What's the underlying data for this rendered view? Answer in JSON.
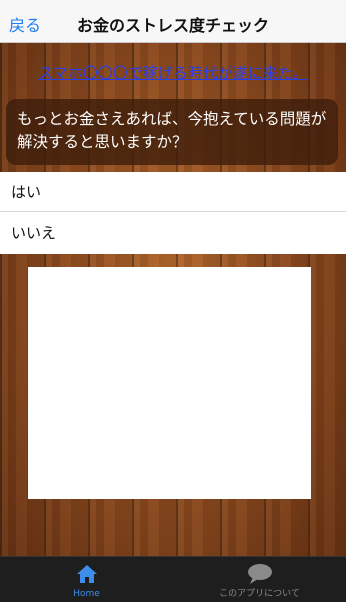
{
  "nav": {
    "back_label": "戻る",
    "title": "お金のストレス度チェック"
  },
  "ad_link": {
    "text": "スマホ〇〇〇で稼げる時代が遂に来た。"
  },
  "question": {
    "text": "もっとお金さえあれば、今抱えている問題が解決すると思いますか？"
  },
  "answers": [
    {
      "label": "はい"
    },
    {
      "label": "いいえ"
    }
  ],
  "tabbar": {
    "tabs": [
      {
        "label": "Home",
        "icon": "home-icon",
        "selected": true
      },
      {
        "label": "このアプリについて",
        "icon": "speech-bubble-icon",
        "selected": false
      }
    ]
  },
  "colors": {
    "link": "#2a3fe8",
    "nav_accent": "#1a7cf2",
    "tab_active": "#3d8ee8",
    "tab_inactive": "#8a8a8a"
  }
}
